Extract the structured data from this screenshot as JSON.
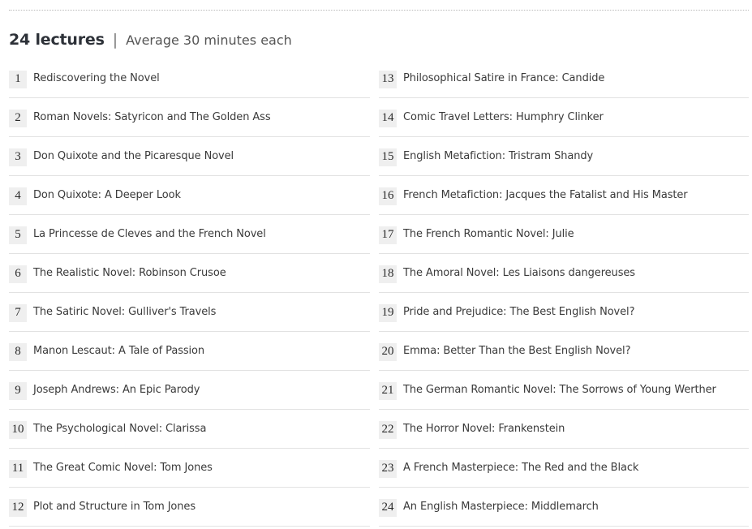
{
  "header": {
    "count_label": "24 lectures",
    "separator": "|",
    "subtitle": "Average 30 minutes each"
  },
  "lectures": [
    {
      "number": "1",
      "title": "Rediscovering the Novel"
    },
    {
      "number": "2",
      "title": "Roman Novels: Satyricon and The Golden Ass"
    },
    {
      "number": "3",
      "title": "Don Quixote and the Picaresque Novel"
    },
    {
      "number": "4",
      "title": "Don Quixote: A Deeper Look"
    },
    {
      "number": "5",
      "title": "La Princesse de Cleves and the French Novel"
    },
    {
      "number": "6",
      "title": "The Realistic Novel: Robinson Crusoe"
    },
    {
      "number": "7",
      "title": "The Satiric Novel: Gulliver's Travels"
    },
    {
      "number": "8",
      "title": "Manon Lescaut: A Tale of Passion"
    },
    {
      "number": "9",
      "title": "Joseph Andrews: An Epic Parody"
    },
    {
      "number": "10",
      "title": "The Psychological Novel: Clarissa"
    },
    {
      "number": "11",
      "title": "The Great Comic Novel: Tom Jones"
    },
    {
      "number": "12",
      "title": "Plot and Structure in Tom Jones"
    },
    {
      "number": "13",
      "title": "Philosophical Satire in France: Candide"
    },
    {
      "number": "14",
      "title": "Comic Travel Letters: Humphry Clinker"
    },
    {
      "number": "15",
      "title": "English Metafiction: Tristram Shandy"
    },
    {
      "number": "16",
      "title": "French Metafiction: Jacques the Fatalist and His Master"
    },
    {
      "number": "17",
      "title": "The French Romantic Novel: Julie"
    },
    {
      "number": "18",
      "title": "The Amoral Novel: Les Liaisons dangereuses"
    },
    {
      "number": "19",
      "title": "Pride and Prejudice: The Best English Novel?"
    },
    {
      "number": "20",
      "title": "Emma: Better Than the Best English Novel?"
    },
    {
      "number": "21",
      "title": "The German Romantic Novel: The Sorrows of Young Werther"
    },
    {
      "number": "22",
      "title": "The Horror Novel: Frankenstein"
    },
    {
      "number": "23",
      "title": "A French Masterpiece: The Red and the Black"
    },
    {
      "number": "24",
      "title": "An English Masterpiece: Middlemarch"
    }
  ]
}
